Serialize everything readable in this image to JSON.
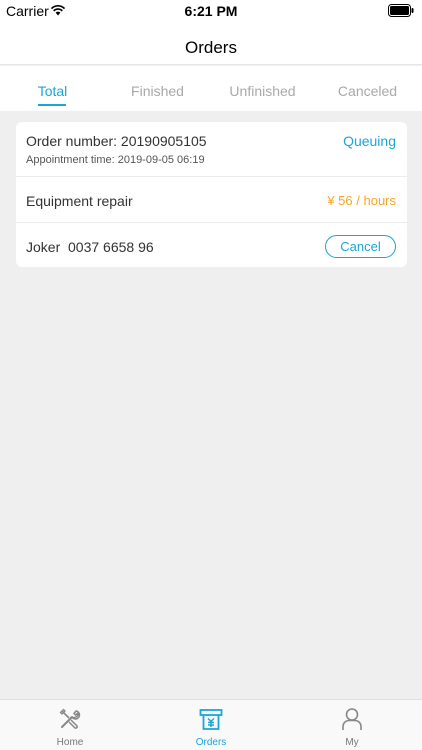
{
  "status_bar": {
    "carrier": "Carrier",
    "time": "6:21 PM"
  },
  "header": {
    "title": "Orders"
  },
  "tabs": [
    {
      "label": "Total",
      "active": true
    },
    {
      "label": "Finished",
      "active": false
    },
    {
      "label": "Unfinished",
      "active": false
    },
    {
      "label": "Canceled",
      "active": false
    }
  ],
  "order": {
    "number_label": "Order number: 20190905105",
    "status": "Queuing",
    "appointment": "Appointment time: 2019-09-05 06:19",
    "service": "Equipment repair",
    "price": "¥ 56 / hours",
    "contact": "Joker  0037 6658 96",
    "cancel_label": "Cancel"
  },
  "tab_bar": [
    {
      "label": "Home",
      "icon": "tools-icon",
      "active": false
    },
    {
      "label": "Orders",
      "icon": "orders-icon",
      "active": true
    },
    {
      "label": "My",
      "icon": "person-icon",
      "active": false
    }
  ],
  "colors": {
    "accent": "#1ba6d6",
    "price": "#f5a623",
    "background": "#efefef"
  }
}
